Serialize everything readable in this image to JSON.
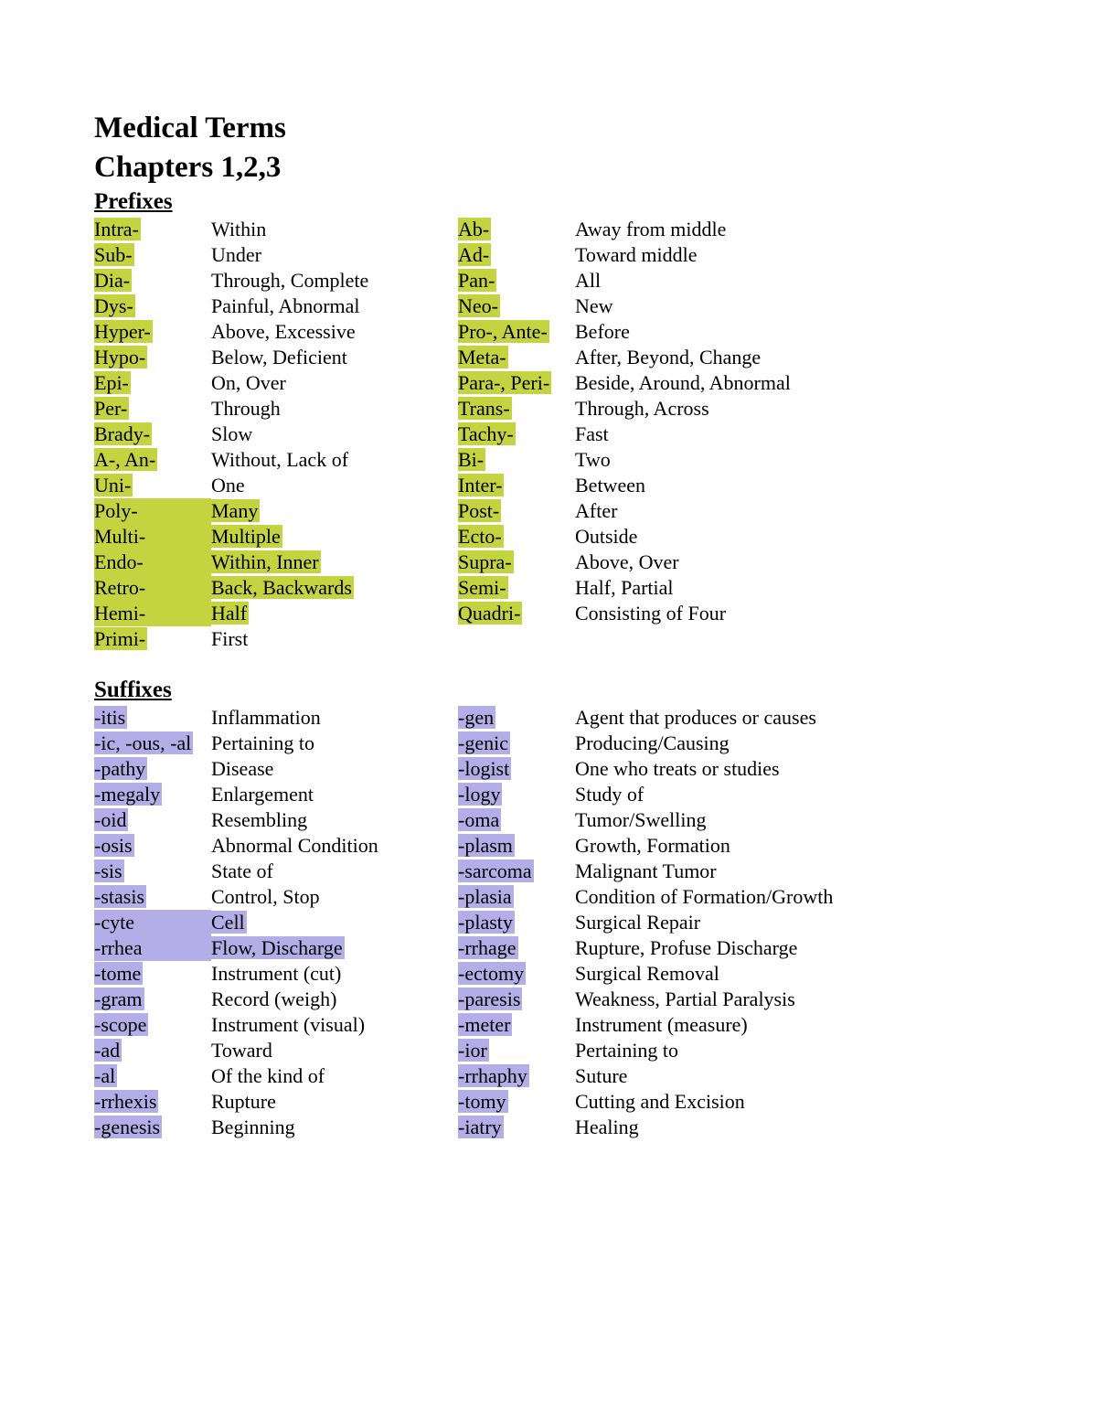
{
  "title1": "Medical Terms",
  "title2": "Chapters 1,2,3",
  "sections": {
    "prefixes": {
      "heading": "Prefixes",
      "highlight": "hl-yellow",
      "left": [
        {
          "term": "Intra-",
          "def": "Within",
          "th": true
        },
        {
          "term": "Sub-",
          "def": "Under",
          "th": true
        },
        {
          "term": "Dia-",
          "def": "Through, Complete",
          "th": true
        },
        {
          "term": "Dys-",
          "def": "Painful, Abnormal",
          "th": true
        },
        {
          "term": "Hyper-",
          "def": "Above, Excessive",
          "th": true
        },
        {
          "term": "Hypo-",
          "def": "Below, Deficient",
          "th": true
        },
        {
          "term": "Epi-",
          "def": "On, Over",
          "th": true
        },
        {
          "term": "Per-",
          "def": "Through",
          "th": true
        },
        {
          "term": "Brady-",
          "def": "Slow",
          "th": true
        },
        {
          "term": "A-, An-",
          "def": "Without, Lack of",
          "th": true
        },
        {
          "term": "Uni-",
          "def": "One",
          "th": true
        },
        {
          "term": "Poly-",
          "def": "Many",
          "th": true,
          "dh": true
        },
        {
          "term": "Multi-",
          "def": "Multiple",
          "th": true,
          "dh": true
        },
        {
          "term": "Endo-",
          "def": "Within, Inner",
          "th": true,
          "dh": true
        },
        {
          "term": "Retro-",
          "def": "Back, Backwards",
          "th": true,
          "dh": true
        },
        {
          "term": "Hemi-",
          "def": "Half",
          "th": true,
          "dh": true
        },
        {
          "term": "Primi-",
          "def": "First",
          "th": true
        }
      ],
      "right": [
        {
          "term": "Ab-",
          "def": "Away from middle",
          "th": true
        },
        {
          "term": "Ad-",
          "def": "Toward middle",
          "th": true
        },
        {
          "term": "Pan-",
          "def": "All",
          "th": true
        },
        {
          "term": "Neo-",
          "def": "New",
          "th": true
        },
        {
          "term": "Pro-, Ante-",
          "def": "Before",
          "th": true
        },
        {
          "term": "Meta-",
          "def": "After, Beyond, Change",
          "th": true
        },
        {
          "term": "Para-, Peri-",
          "def": "Beside, Around, Abnormal",
          "th": true
        },
        {
          "term": "Trans-",
          "def": "Through, Across",
          "th": true
        },
        {
          "term": "Tachy-",
          "def": "Fast",
          "th": true
        },
        {
          "term": "Bi-",
          "def": "Two",
          "th": true
        },
        {
          "term": "Inter-",
          "def": "Between",
          "th": true
        },
        {
          "term": "Post-",
          "def": "After",
          "th": true
        },
        {
          "term": "Ecto-",
          "def": "Outside",
          "th": true
        },
        {
          "term": "Supra-",
          "def": "Above, Over",
          "th": true
        },
        {
          "term": "Semi-",
          "def": "Half, Partial",
          "th": true
        },
        {
          "term": "Quadri-",
          "def": "Consisting of Four",
          "th": true
        }
      ]
    },
    "suffixes": {
      "heading": "Suffixes",
      "highlight": "hl-purple",
      "left": [
        {
          "term": "-itis",
          "def": "Inflammation",
          "th": true
        },
        {
          "term": "-ic, -ous, -al",
          "def": "Pertaining to",
          "th": true
        },
        {
          "term": "-pathy",
          "def": "Disease",
          "th": true
        },
        {
          "term": "-megaly",
          "def": "Enlargement",
          "th": true
        },
        {
          "term": "-oid",
          "def": "Resembling",
          "th": true
        },
        {
          "term": "-osis",
          "def": "Abnormal Condition",
          "th": true
        },
        {
          "term": "-sis",
          "def": "State of",
          "th": true
        },
        {
          "term": "-stasis",
          "def": "Control, Stop",
          "th": true
        },
        {
          "term": "-cyte",
          "def": "Cell",
          "th": true,
          "dh": true
        },
        {
          "term": "-rrhea",
          "def": "Flow, Discharge",
          "th": true,
          "dh": true
        },
        {
          "term": "-tome",
          "def": "Instrument (cut)",
          "th": true
        },
        {
          "term": "-gram",
          "def": "Record (weigh)",
          "th": true
        },
        {
          "term": "-scope",
          "def": "Instrument (visual)",
          "th": true
        },
        {
          "term": "-ad",
          "def": "Toward",
          "th": true
        },
        {
          "term": "-al",
          "def": "Of the kind of",
          "th": true
        },
        {
          "term": "-rrhexis",
          "def": "Rupture",
          "th": true
        },
        {
          "term": "-genesis",
          "def": "Beginning",
          "th": true
        }
      ],
      "right": [
        {
          "term": "-gen",
          "def": "Agent that produces or causes",
          "th": true
        },
        {
          "term": "-genic",
          "def": "Producing/Causing",
          "th": true
        },
        {
          "term": "-logist",
          "def": "One who treats or studies",
          "th": true
        },
        {
          "term": "-logy",
          "def": "Study of",
          "th": true
        },
        {
          "term": "-oma",
          "def": "Tumor/Swelling",
          "th": true
        },
        {
          "term": "-plasm",
          "def": "Growth, Formation",
          "th": true
        },
        {
          "term": "-sarcoma",
          "def": "Malignant Tumor",
          "th": true
        },
        {
          "term": "-plasia",
          "def": "Condition of Formation/Growth",
          "th": true
        },
        {
          "term": "-plasty",
          "def": "Surgical Repair",
          "th": true
        },
        {
          "term": "-rrhage",
          "def": "Rupture, Profuse Discharge",
          "th": true
        },
        {
          "term": "-ectomy",
          "def": "Surgical Removal",
          "th": true
        },
        {
          "term": "-paresis",
          "def": "Weakness, Partial Paralysis",
          "th": true
        },
        {
          "term": "-meter",
          "def": "Instrument (measure)",
          "th": true
        },
        {
          "term": "-ior",
          "def": "Pertaining to",
          "th": true
        },
        {
          "term": "-rrhaphy",
          "def": "Suture",
          "th": true
        },
        {
          "term": "-tomy",
          "def": "Cutting and Excision",
          "th": true
        },
        {
          "term": "-iatry",
          "def": "Healing",
          "th": true
        }
      ]
    }
  }
}
